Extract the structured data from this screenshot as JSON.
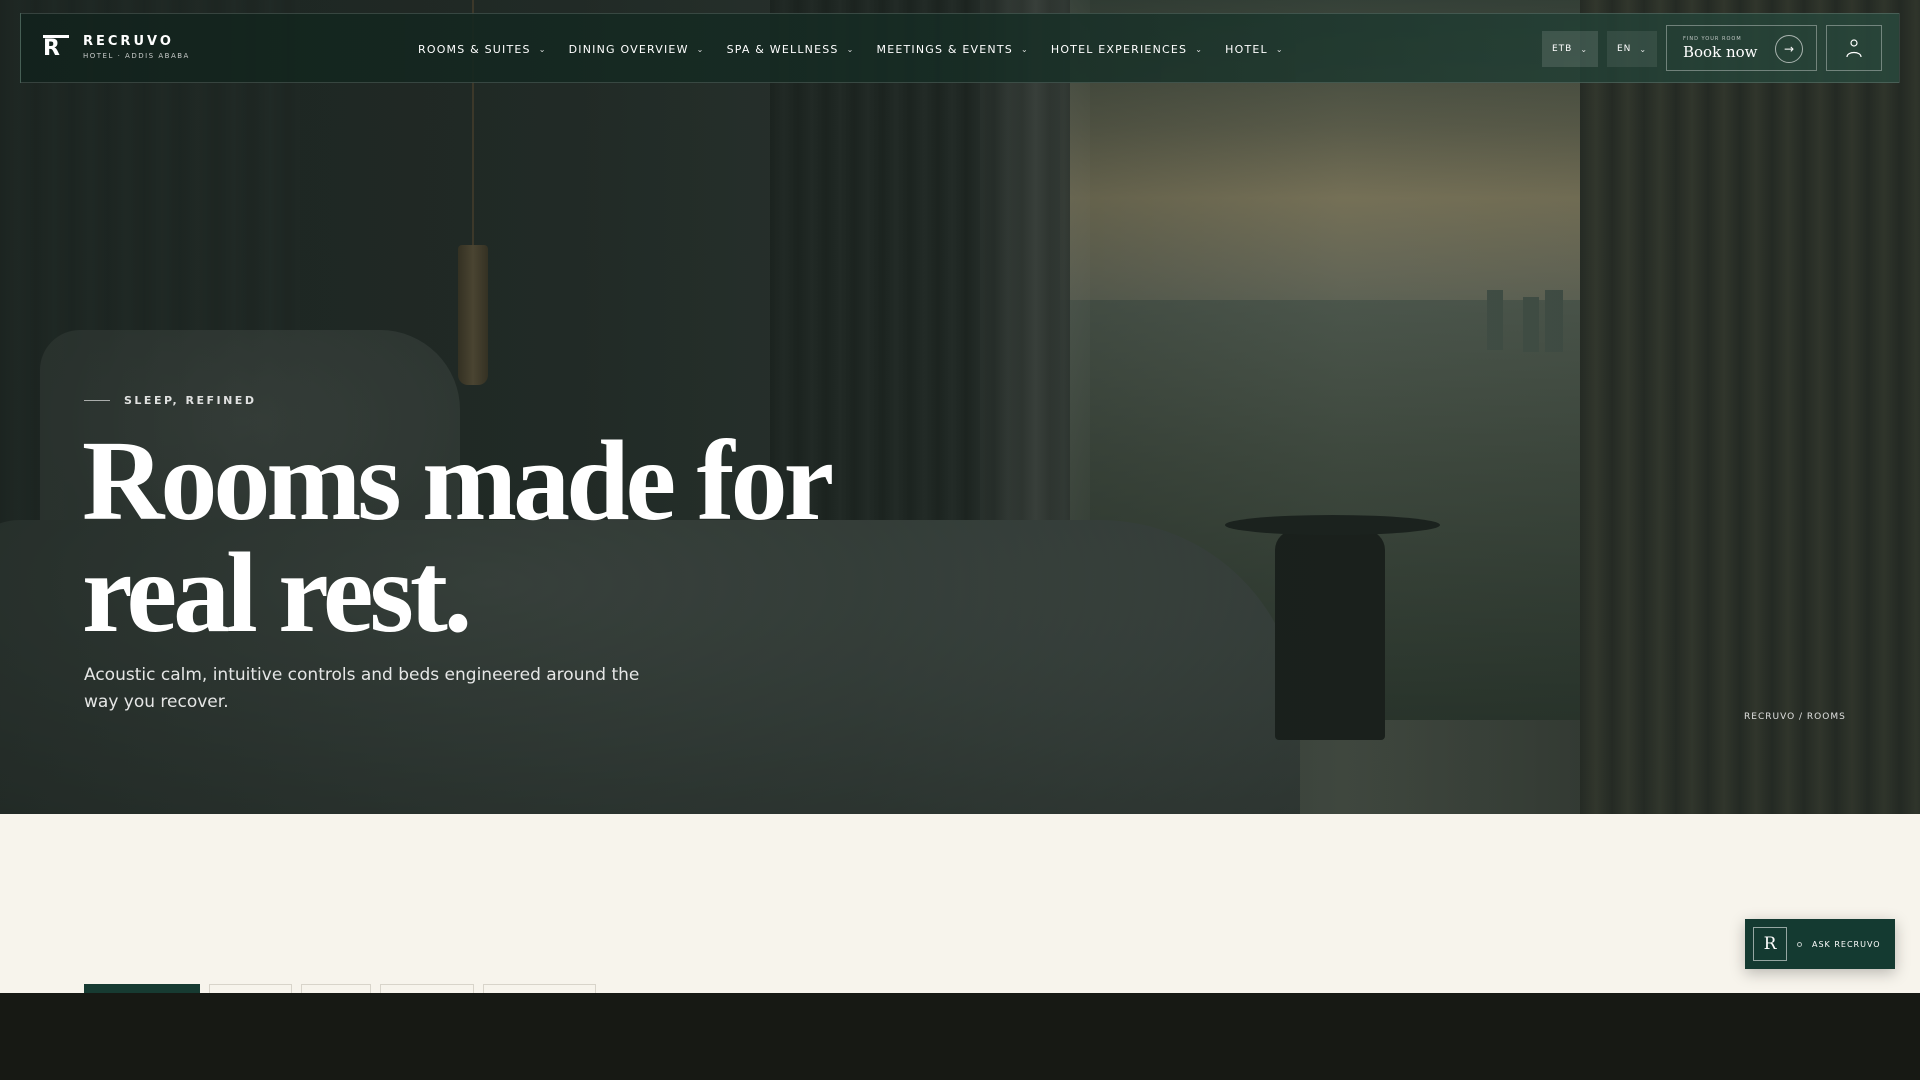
{
  "brand": {
    "name": "RECRUVO",
    "subtitle": "HOTEL · ADDIS ABABA"
  },
  "nav": {
    "items": [
      {
        "label": "ROOMS & SUITES"
      },
      {
        "label": "DINING OVERVIEW"
      },
      {
        "label": "SPA & WELLNESS"
      },
      {
        "label": "MEETINGS & EVENTS"
      },
      {
        "label": "HOTEL EXPERIENCES"
      },
      {
        "label": "HOTEL"
      }
    ],
    "currency": "ETB",
    "language": "EN",
    "book": {
      "eyebrow": "FIND YOUR ROOM",
      "label": "Book now"
    }
  },
  "hero": {
    "eyebrow": "SLEEP, REFINED",
    "title": "Rooms made for real rest.",
    "lead": "Acoustic calm, intuitive controls and beds engineered around the way you recover.",
    "breadcrumb": "RECRUVO / ROOMS"
  },
  "assistant": {
    "initial": "R",
    "label": "ASK RECRUVO"
  },
  "colors": {
    "accent": "#173b32",
    "cream": "#f7f4ec",
    "footer": "#171914"
  },
  "icons": [
    "chevron-down-icon",
    "arrow-right-icon",
    "user-icon",
    "logo-icon"
  ]
}
